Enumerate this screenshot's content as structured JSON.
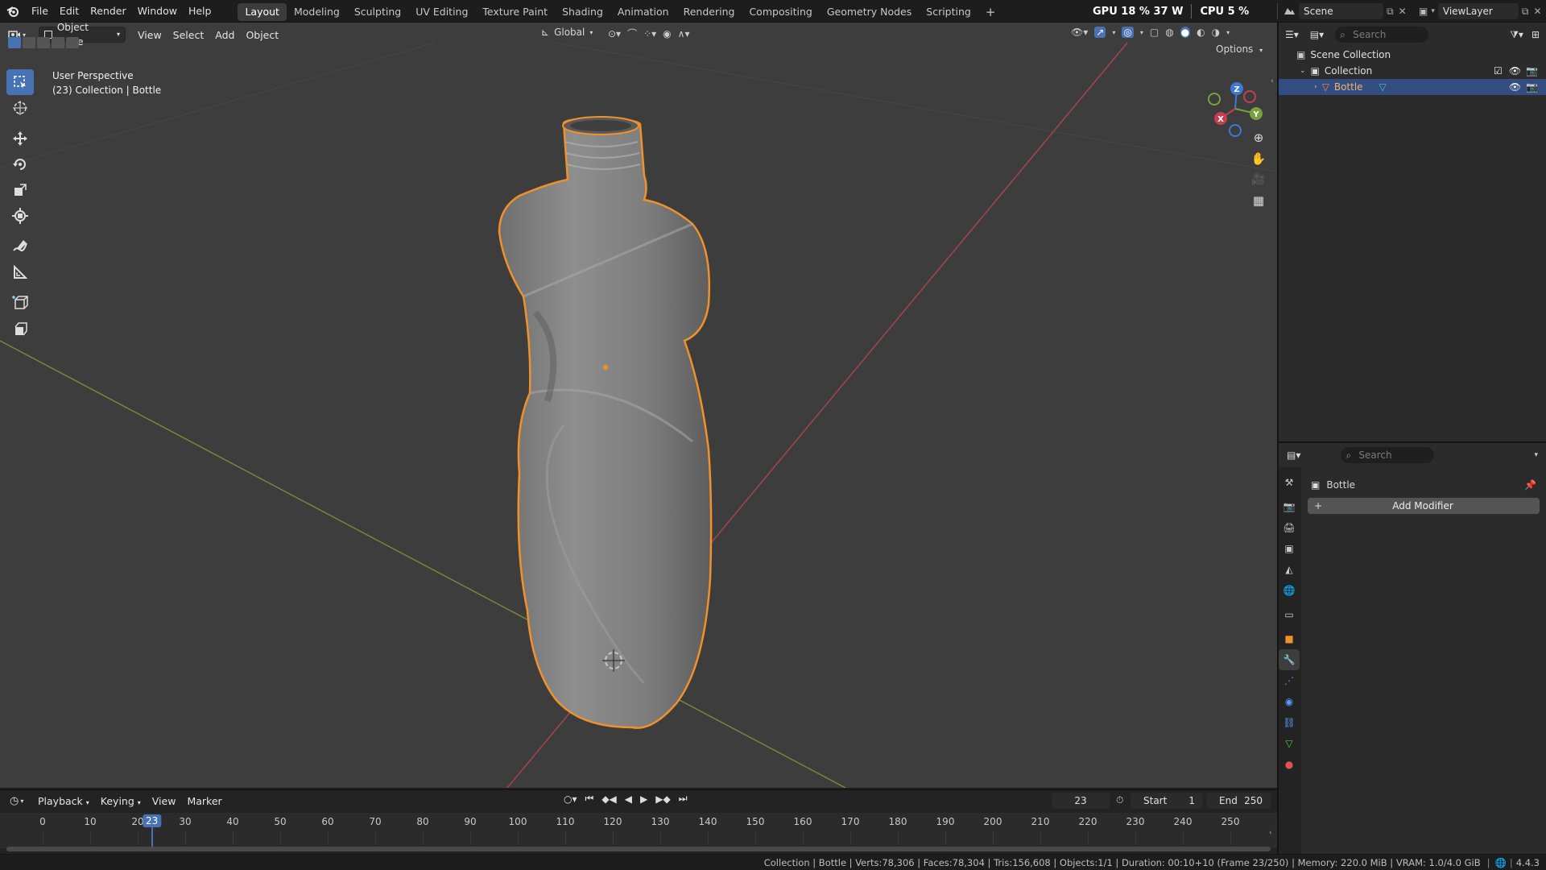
{
  "menu": [
    "File",
    "Edit",
    "Render",
    "Window",
    "Help"
  ],
  "workspaces": [
    "Layout",
    "Modeling",
    "Sculpting",
    "UV Editing",
    "Texture Paint",
    "Shading",
    "Animation",
    "Rendering",
    "Compositing",
    "Geometry Nodes",
    "Scripting"
  ],
  "active_workspace": "Layout",
  "add_workspace_label": "+",
  "perf": {
    "gpu_label": "GPU",
    "gpu_value": "18 %",
    "gpu_watts": "37 W",
    "cpu_label": "CPU",
    "cpu_value": "5 %"
  },
  "scene": {
    "name": "Scene",
    "view_layer": "ViewLayer"
  },
  "viewport": {
    "mode": "Object Mode",
    "menus": [
      "View",
      "Select",
      "Add",
      "Object"
    ],
    "transform_orientation": "Global",
    "options_label": "Options",
    "overlay_title": "User Perspective",
    "overlay_subtitle": "(23) Collection | Bottle",
    "gizmo": {
      "x": "X",
      "y": "Y",
      "z": "Z"
    }
  },
  "tools": [
    "select-box-icon",
    "cursor-icon",
    "move-icon",
    "rotate-icon",
    "scale-icon",
    "transform-icon",
    "annotate-icon",
    "measure-icon",
    "add-cube-icon",
    "extrude-icon"
  ],
  "timeline": {
    "menus": [
      "Playback",
      "Keying",
      "View",
      "Marker"
    ],
    "current_frame": "23",
    "start_label": "Start",
    "start": "1",
    "end_label": "End",
    "end": "250",
    "ticks": [
      "0",
      "10",
      "20",
      "30",
      "40",
      "50",
      "60",
      "70",
      "80",
      "90",
      "100",
      "110",
      "120",
      "130",
      "140",
      "150",
      "160",
      "170",
      "180",
      "190",
      "200",
      "210",
      "220",
      "230",
      "240",
      "250"
    ]
  },
  "outliner": {
    "search_placeholder": "Search",
    "scene_collection": "Scene Collection",
    "collection": "Collection",
    "object": "Bottle"
  },
  "properties": {
    "search_placeholder": "Search",
    "object_name": "Bottle",
    "add_modifier": "Add Modifier",
    "add_icon": "+"
  },
  "status": "Collection | Bottle | Verts:78,306 | Faces:78,304 | Tris:156,608 | Objects:1/1 | Duration: 00:10+10 (Frame 23/250) | Memory: 220.0 MiB | VRAM: 1.0/4.0 GiB",
  "version": "4.4.3",
  "colors": {
    "accent": "#4772b3",
    "selection": "#f0912b",
    "x_axis": "#c5404f",
    "y_axis": "#7aa03c",
    "z_axis": "#3c7ad6"
  }
}
